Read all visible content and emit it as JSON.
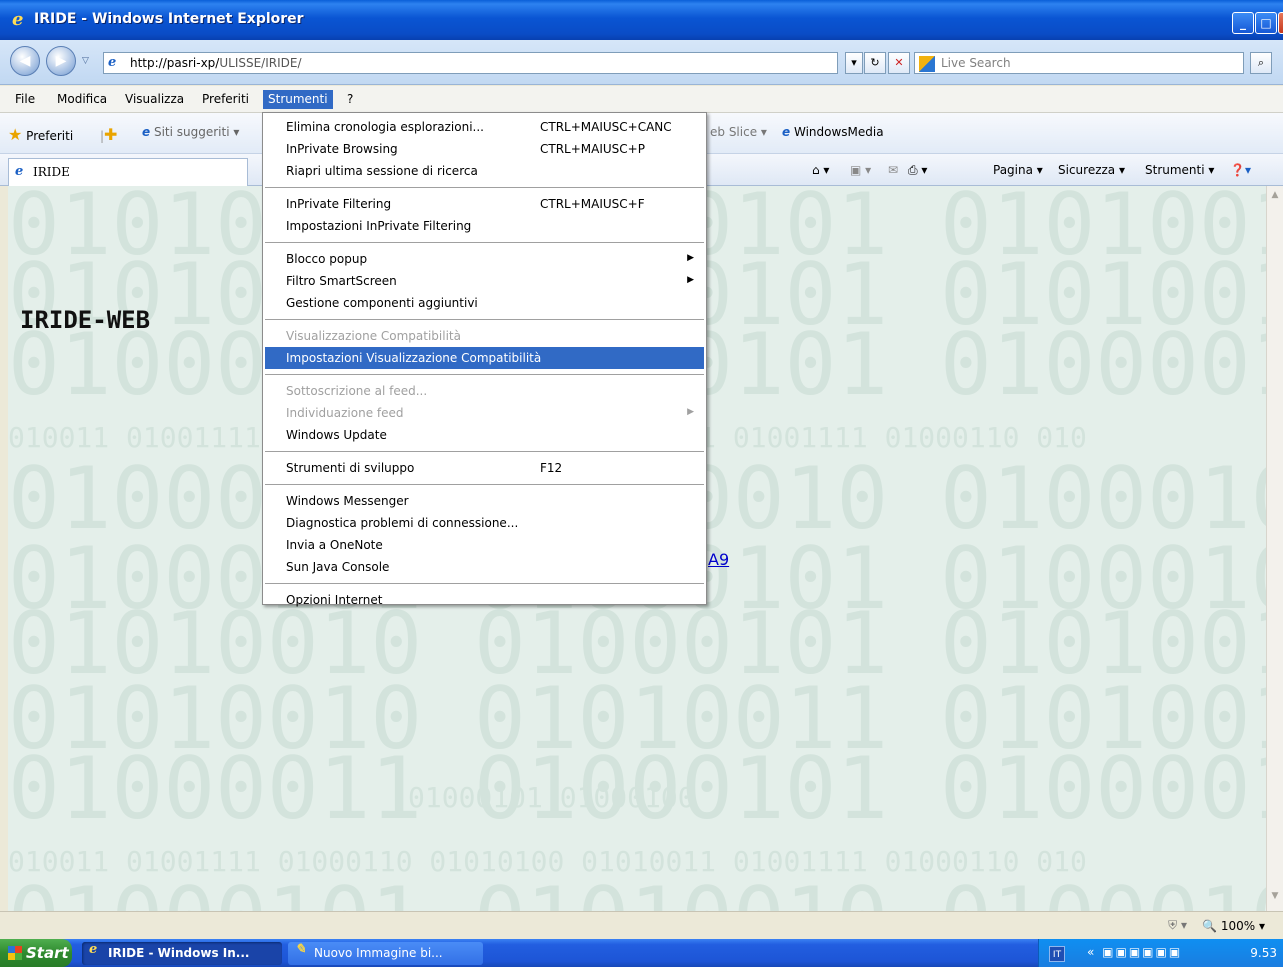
{
  "window": {
    "title": "IRIDE - Windows Internet Explorer",
    "buttons": [
      "_",
      "□",
      "×"
    ]
  },
  "addressbar": {
    "url_host": "http://pasri-xp/",
    "url_path": "ULISSE/IRIDE/",
    "search_placeholder": "Live Search"
  },
  "menubar": {
    "items": [
      "File",
      "Modifica",
      "Visualizza",
      "Preferiti",
      "Strumenti",
      "?"
    ]
  },
  "favorites": {
    "favorites_label": "Preferiti",
    "suggested": "Siti suggeriti ▾",
    "webslice": "eb Slice ▾",
    "windowsmedia": "WindowsMedia"
  },
  "tab": {
    "label": "IRIDE"
  },
  "commandbar": {
    "page": "Pagina ▾",
    "safety": "Sicurezza ▾",
    "tools": "Strumenti ▾"
  },
  "page": {
    "title": "IRIDE-WEB",
    "link_tail": "A9"
  },
  "background": {
    "big_lines": [
      "01010010 01000101 01010010 01000101",
      "01010010 01000101 01010010 01000101",
      "01000011 01000101 01000011 01000101",
      "01000101 01010010 01000101 01010010",
      "01000101 01000101 01000101 01000101",
      "01010010 01000101 01010010 01000101",
      "01010010 01010011 01010010 01010011",
      "01000011 01000101 01000011 01000101",
      "01000101 01010010 01000101 01010010"
    ],
    "small_lines": [
      "010011 01001111 01000110 01010100 01010011 01001111 01000110 010",
      "010011 01001111 01000110 01010100 01010011 01001111 01000110 010"
    ],
    "mid_small": "01000101 01000100"
  },
  "dropdown": {
    "groups": [
      [
        {
          "label": "Elimina cronologia esplorazioni...",
          "shortcut": "CTRL+MAIUSC+CANC",
          "state": "normal",
          "submenu": false
        },
        {
          "label": "InPrivate Browsing",
          "shortcut": "CTRL+MAIUSC+P",
          "state": "normal",
          "submenu": false
        },
        {
          "label": "Riapri ultima sessione di ricerca",
          "shortcut": "",
          "state": "normal",
          "submenu": false
        }
      ],
      [
        {
          "label": "InPrivate Filtering",
          "shortcut": "CTRL+MAIUSC+F",
          "state": "normal",
          "submenu": false
        },
        {
          "label": "Impostazioni InPrivate Filtering",
          "shortcut": "",
          "state": "normal",
          "submenu": false
        }
      ],
      [
        {
          "label": "Blocco popup",
          "shortcut": "",
          "state": "normal",
          "submenu": true
        },
        {
          "label": "Filtro SmartScreen",
          "shortcut": "",
          "state": "normal",
          "submenu": true
        },
        {
          "label": "Gestione componenti aggiuntivi",
          "shortcut": "",
          "state": "normal",
          "submenu": false
        }
      ],
      [
        {
          "label": "Visualizzazione Compatibilità",
          "shortcut": "",
          "state": "disabled",
          "submenu": false
        },
        {
          "label": "Impostazioni Visualizzazione Compatibilità",
          "shortcut": "",
          "state": "highlighted",
          "submenu": false
        }
      ],
      [
        {
          "label": "Sottoscrizione al feed...",
          "shortcut": "",
          "state": "disabled",
          "submenu": false
        },
        {
          "label": "Individuazione feed",
          "shortcut": "",
          "state": "disabled",
          "submenu": true
        },
        {
          "label": "Windows Update",
          "shortcut": "",
          "state": "normal",
          "submenu": false
        }
      ],
      [
        {
          "label": "Strumenti di sviluppo",
          "shortcut": "F12",
          "state": "normal",
          "submenu": false
        }
      ],
      [
        {
          "label": "Windows Messenger",
          "shortcut": "",
          "state": "normal",
          "submenu": false
        },
        {
          "label": "Diagnostica problemi di connessione...",
          "shortcut": "",
          "state": "normal",
          "submenu": false
        },
        {
          "label": "Invia a OneNote",
          "shortcut": "",
          "state": "normal",
          "submenu": false
        },
        {
          "label": "Sun Java Console",
          "shortcut": "",
          "state": "normal",
          "submenu": false
        }
      ],
      [
        {
          "label": "Opzioni Internet",
          "shortcut": "",
          "state": "normal",
          "submenu": false
        }
      ]
    ]
  },
  "statusbar": {
    "zoom": "100%"
  },
  "taskbar": {
    "start": "Start",
    "buttons": [
      {
        "label": "IRIDE - Windows In...",
        "active": true
      },
      {
        "label": "Nuovo Immagine bi...",
        "active": false
      }
    ],
    "lang": "IT",
    "clock": "9.53"
  },
  "colors": {
    "menu_highlight": "#316ac5",
    "content_bg": "#e4efea",
    "link": "#0000cc"
  }
}
